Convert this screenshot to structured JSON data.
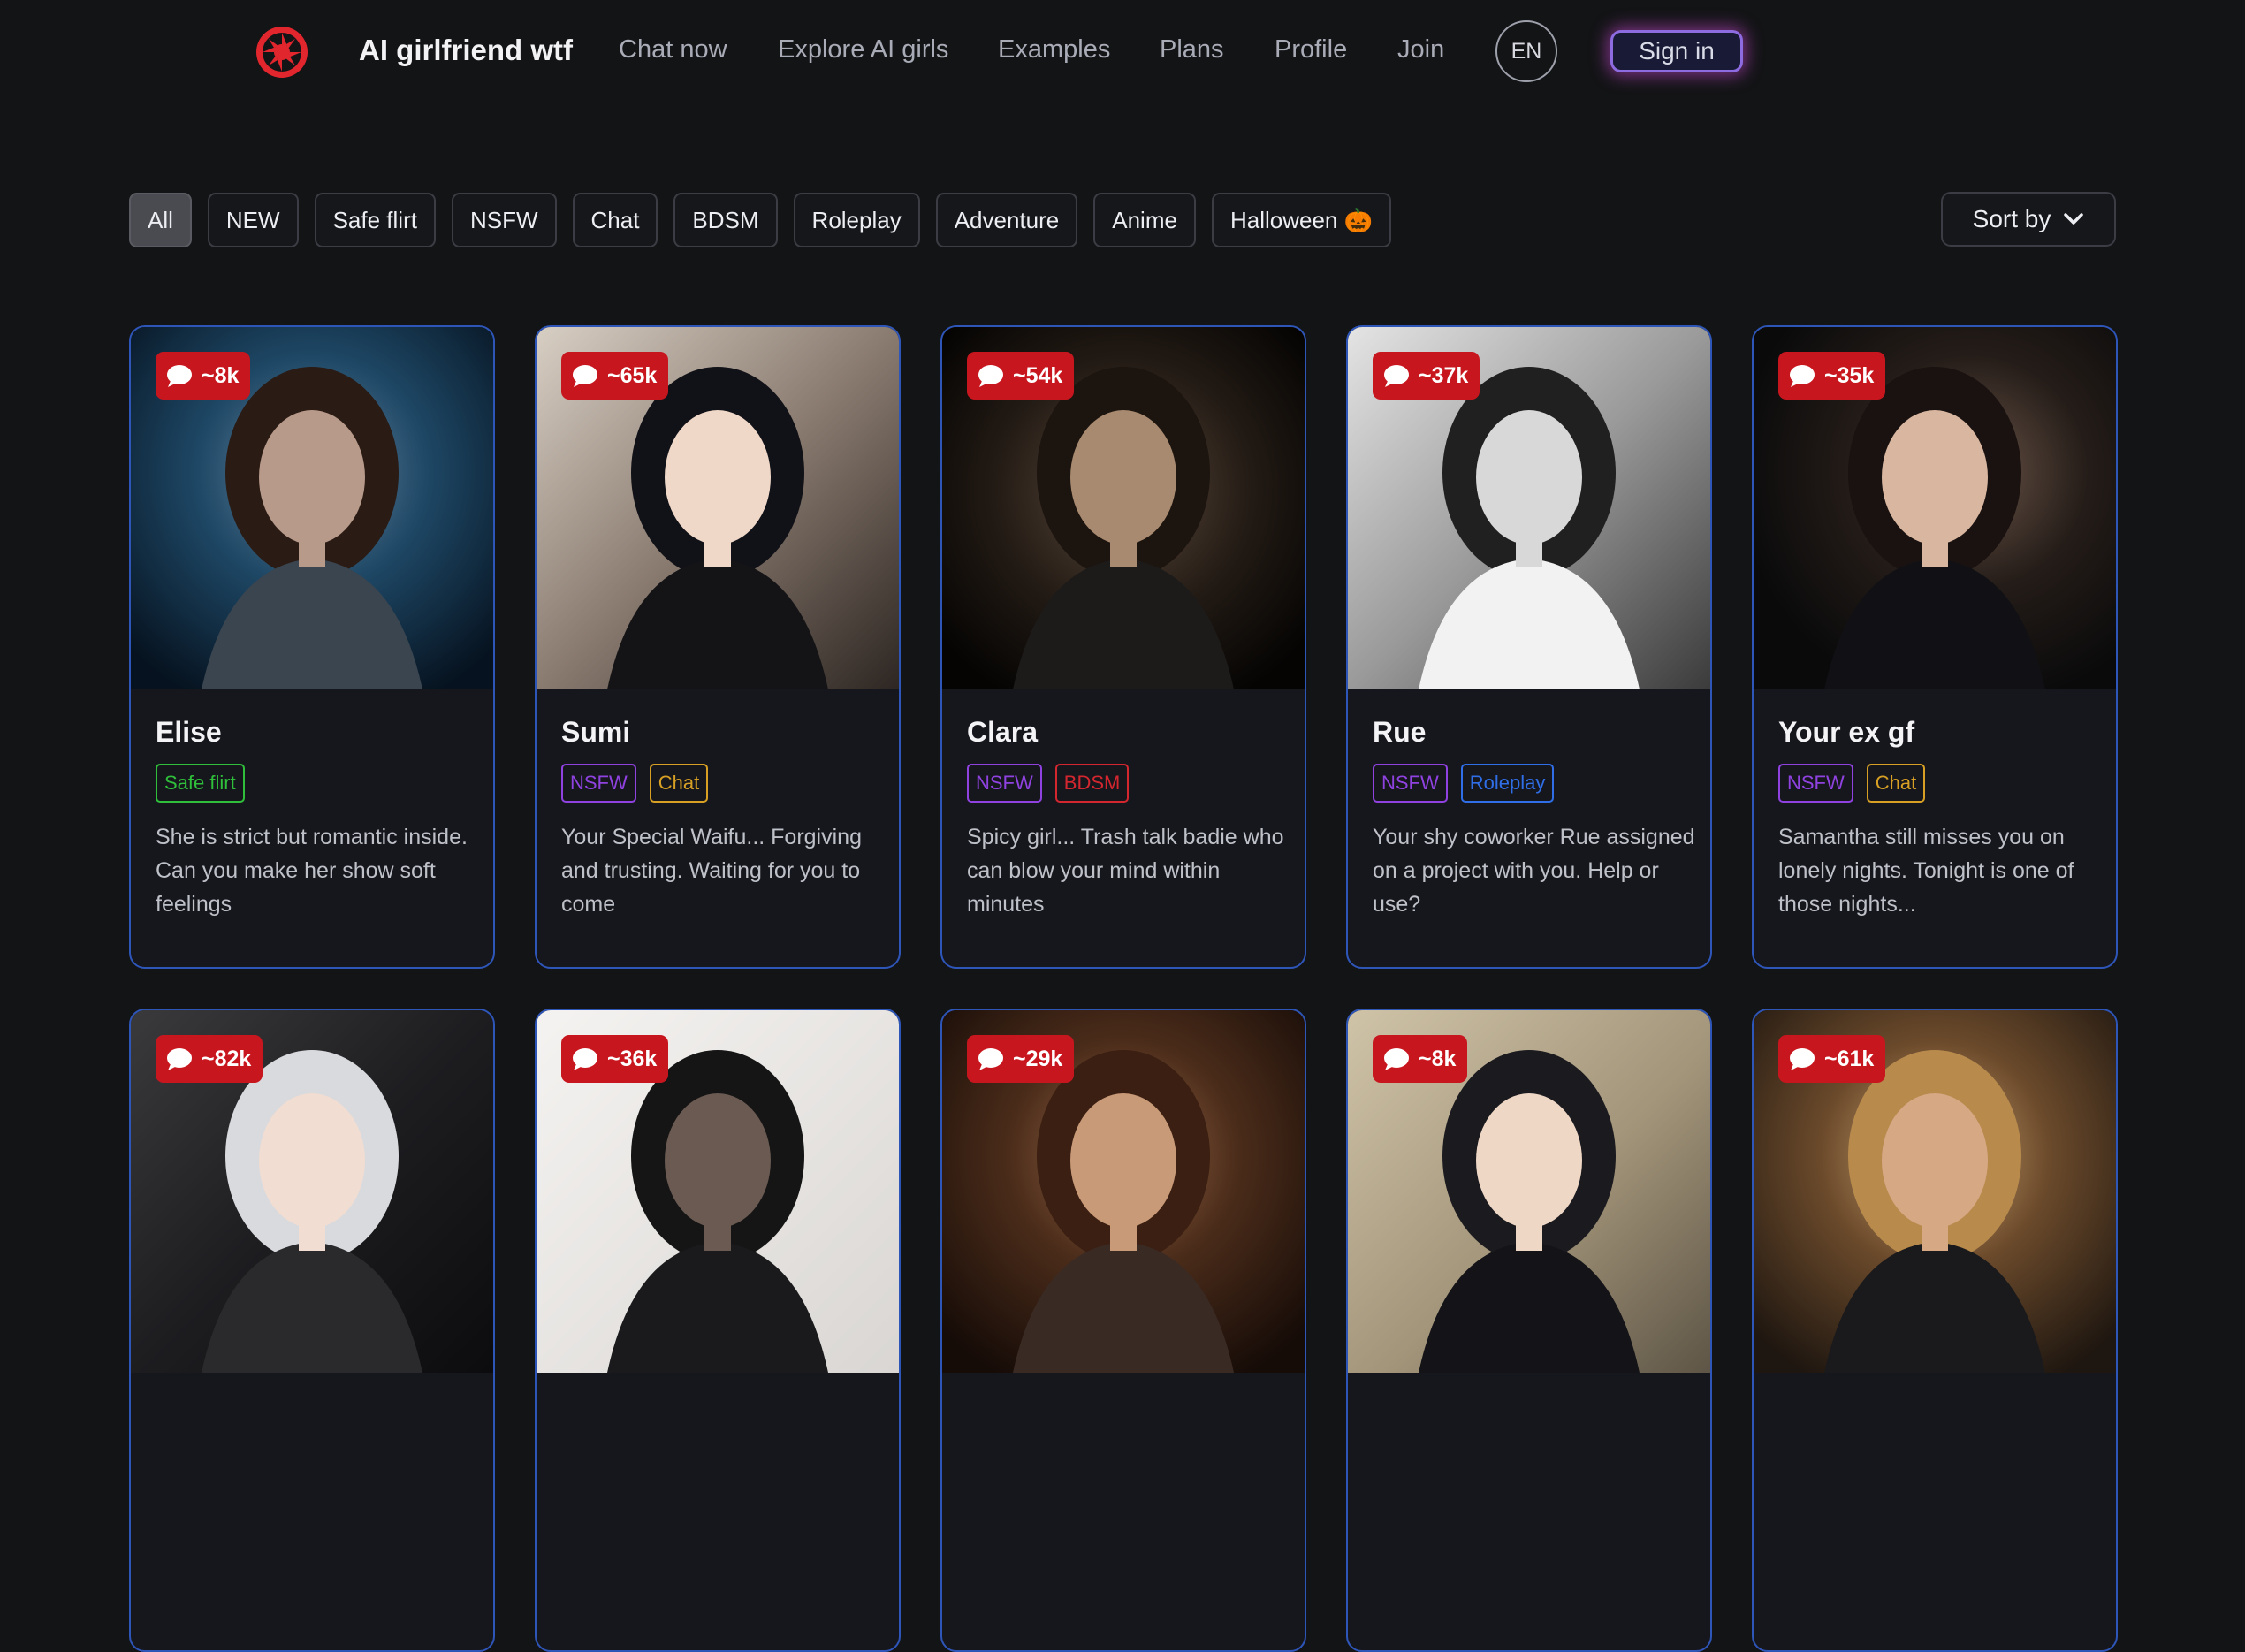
{
  "header": {
    "brand": "AI girlfriend wtf",
    "nav": [
      "Chat now",
      "Explore AI girls",
      "Examples",
      "Plans",
      "Profile",
      "Join"
    ],
    "lang": "EN",
    "signin_label": "Sign in"
  },
  "filters": {
    "chips": [
      "All",
      "NEW",
      "Safe flirt",
      "NSFW",
      "Chat",
      "BDSM",
      "Roleplay",
      "Adventure",
      "Anime",
      "Halloween 🎃"
    ],
    "active": "All",
    "sort_label": "Sort by"
  },
  "tag_colors": {
    "Safe flirt": "#2fbf3a",
    "NSFW": "#8f42e0",
    "Chat": "#d7a024",
    "BDSM": "#d4262f",
    "Roleplay": "#2f6ee6"
  },
  "colors": {
    "badge": "#c8161f",
    "card_border": "#2e55b8",
    "background": "#131416"
  },
  "cards": [
    {
      "name": "Elise",
      "count": "~8k",
      "tags": [
        "Safe flirt"
      ],
      "desc": "She is strict but romantic inside. Can you make her show soft feelings",
      "image": "cyborg woman, blue neon bokeh"
    },
    {
      "name": "Sumi",
      "count": "~65k",
      "tags": [
        "NSFW",
        "Chat"
      ],
      "desc": "Your Special Waifu... Forgiving and trusting. Waiting for you to come",
      "image": "anime girl in black dress"
    },
    {
      "name": "Clara",
      "count": "~54k",
      "tags": [
        "NSFW",
        "BDSM"
      ],
      "desc": "Spicy girl... Trash talk badie who can blow your mind within minutes",
      "image": "dark portrait close-up"
    },
    {
      "name": "Rue",
      "count": "~37k",
      "tags": [
        "NSFW",
        "Roleplay"
      ],
      "desc": "Your shy coworker Rue assigned on a project with you. Help or use?",
      "image": "monochrome manga coworker"
    },
    {
      "name": "Your ex gf",
      "count": "~35k",
      "tags": [
        "NSFW",
        "Chat"
      ],
      "desc": "Samantha still misses you on lonely nights. Tonight is one of those nights...",
      "image": "dark-haired woman portrait"
    },
    {
      "name": "",
      "count": "~82k",
      "tags": [],
      "desc": "",
      "image": "white-haired anime girl"
    },
    {
      "name": "",
      "count": "~36k",
      "tags": [],
      "desc": "",
      "image": "woman in black tights on leather chair"
    },
    {
      "name": "",
      "count": "~29k",
      "tags": [],
      "desc": "",
      "image": "curly-haired woman, warm bokeh"
    },
    {
      "name": "",
      "count": "~8k",
      "tags": [],
      "desc": "",
      "image": "anime girl with paintings"
    },
    {
      "name": "",
      "count": "~61k",
      "tags": [],
      "desc": "",
      "image": "blonde woman holding mug"
    }
  ]
}
